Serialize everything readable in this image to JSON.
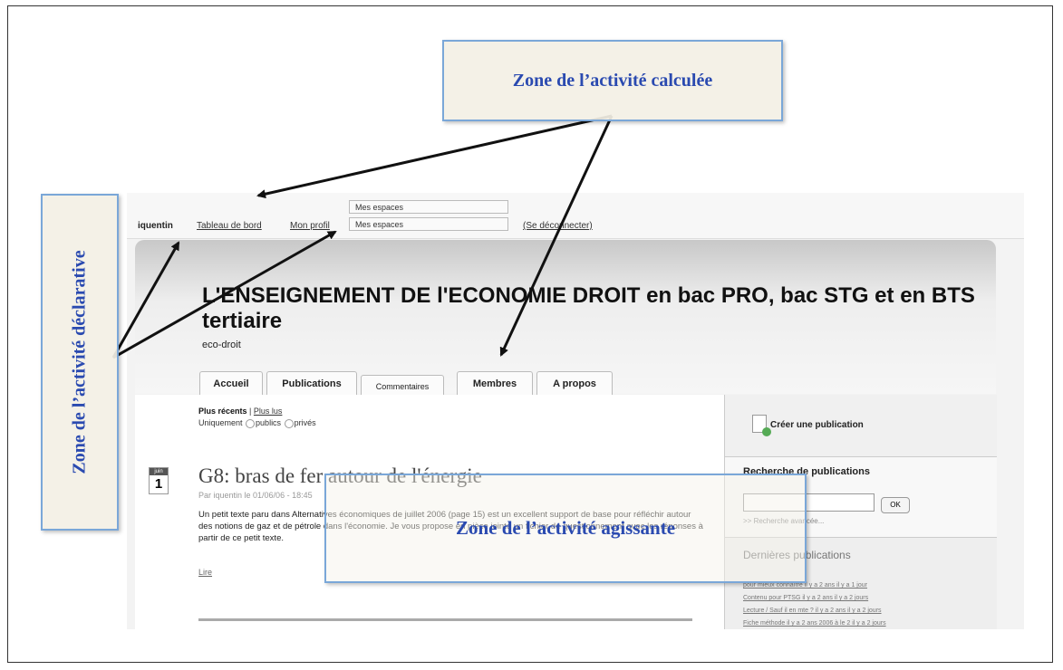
{
  "annotations": {
    "top": "Zone de l’activité calculée",
    "left": "Zone de l’activité déclarative",
    "middle": "Zone de l’activité agissante"
  },
  "topnav": {
    "user": "iquentin",
    "dashboard": "Tableau de bord",
    "profile": "Mon profil",
    "spaces_1": "Mes espaces",
    "spaces_2": "Mes espaces",
    "logout": "(Se déconnecter)"
  },
  "header": {
    "title": "L'ENSEIGNEMENT DE l'ECONOMIE DROIT en bac PRO, bac STG et en BTS tertiaire",
    "subtitle": "eco-droit"
  },
  "tabs": [
    "Accueil",
    "Publications",
    "Commentaires",
    "Membres",
    "A propos"
  ],
  "filter": {
    "recent": "Plus récents",
    "sep": "|",
    "most_read": "Plus lus",
    "only": "Uniquement",
    "public": "publics",
    "private": "privés"
  },
  "post": {
    "month": "juin",
    "day": "1",
    "title": "G8: bras de fer autour de l'énergie",
    "meta": "Par iquentin le 01/06/06 - 18:45",
    "body": "Un petit texte paru dans Alternatives économiques de juillet 2006 (page 15) est un excellent support de base pour réfléchir autour des notions de gaz et de pétrole dans l'économie. Je vous propose en pièce jointe un fichier de questionnement avec les réponses à partir de ce petit texte.",
    "read": "Lire"
  },
  "sidebar": {
    "create": "Créer une publication",
    "search_title": "Recherche de publications",
    "ok": "OK",
    "advanced": ">> Recherche avancée...",
    "latest_title": "Dernières publications",
    "latest_items": [
      "pour mieux connaître il y a 2 ans il y a 1 jour",
      "Contenu pour PTSG il y a 2 ans il y a 2 jours",
      "Lecture / Sauf il en mte ? il y a 2 ans il y a 2 jours",
      "Fiche méthode il y a 2 ans 2006 à le 2 il y a 2 jours"
    ]
  }
}
